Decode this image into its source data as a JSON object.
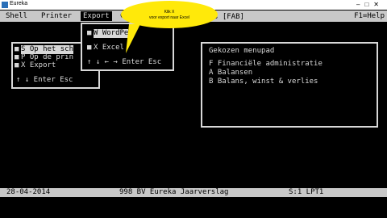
{
  "window": {
    "title": "Eureka"
  },
  "menu": [
    {
      "label": "Shell"
    },
    {
      "label": "Printer"
    },
    {
      "label": "Export"
    },
    {
      "label": "C"
    }
  ],
  "help": "F1=Help",
  "screen_title": "s [FAB]",
  "left_panel": {
    "items": [
      "S Op het sch",
      "P Op de prin",
      "X Export"
    ],
    "hint": "↑ ↓ Enter Esc"
  },
  "export_menu": {
    "items": [
      "W WordPe",
      "X Excel"
    ],
    "hint": "↑ ↓ ← → Enter Esc"
  },
  "tooltip": {
    "line1": "Klik X",
    "line2": "voor export naar Excel"
  },
  "right_panel": {
    "title": "Gekozen menupad",
    "items": [
      "F Financiële administratie",
      "A Balansen",
      "B Balans, winst & verlies"
    ]
  },
  "status": {
    "date": "28-04-2014",
    "company": "998 BV Eureka Jaarverslag",
    "printer": "S:1 LPT1"
  }
}
